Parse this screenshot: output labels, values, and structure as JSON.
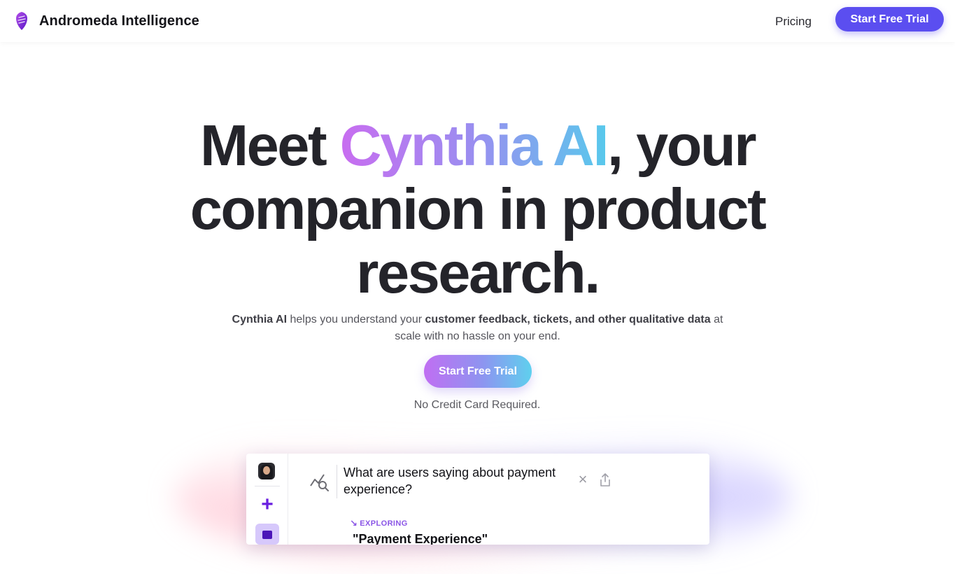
{
  "header": {
    "brand_name": "Andromeda Intelligence",
    "logo_icon": "shield-logo-icon",
    "nav_pricing": "Pricing",
    "cta_label": "Start Free Trial"
  },
  "hero": {
    "title_part1": "Meet ",
    "title_highlight": "Cynthia AI",
    "title_part2": ", your companion in product research.",
    "subtitle": {
      "s1_bold": "Cynthia AI",
      "s2": " helps you understand your ",
      "s3_bold": "customer feedback, tickets, and other qualitative data",
      "s4": " at scale with no hassle on your end."
    },
    "cta_label": "Start Free Trial",
    "note": "No Credit Card Required."
  },
  "preview": {
    "question": "What are users saying about payment experience?",
    "status_label": "EXPLORING",
    "topic_title": "\"Payment Experience\"",
    "icons": [
      "avatar",
      "plus-icon",
      "chat-icon",
      "trend-search-icon",
      "close-icon",
      "share-icon"
    ]
  },
  "colors": {
    "accent": "#5b4ef0",
    "gradient_start": "#c86df0",
    "gradient_end": "#58c9ec",
    "title_text": "#24242a"
  }
}
